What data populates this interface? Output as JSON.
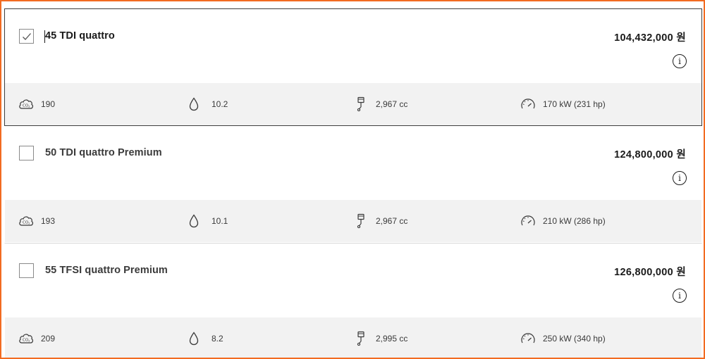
{
  "currency": "원",
  "models": [
    {
      "name": "45 TDI quattro",
      "price": "104,432,000 원",
      "selected": true,
      "co2": "190",
      "fuel": "10.2",
      "displacement": "2,967 cc",
      "power": "170 kW (231 hp)"
    },
    {
      "name": "50 TDI quattro Premium",
      "price": "124,800,000 원",
      "selected": false,
      "co2": "193",
      "fuel": "10.1",
      "displacement": "2,967 cc",
      "power": "210 kW (286 hp)"
    },
    {
      "name": "55 TFSI quattro Premium",
      "price": "126,800,000 원",
      "selected": false,
      "co2": "209",
      "fuel": "8.2",
      "displacement": "2,995 cc",
      "power": "250 kW (340 hp)"
    }
  ],
  "icons": {
    "checkmark": "checkmark-icon",
    "info": "info-icon",
    "co2": "co2-cloud-icon",
    "fuel": "fuel-drop-icon",
    "displacement": "engine-piston-icon",
    "power": "speedometer-icon"
  },
  "colors": {
    "frame_border": "#f26b21",
    "spec_background": "#f2f2f2",
    "selected_border": "#3d3d3d"
  }
}
